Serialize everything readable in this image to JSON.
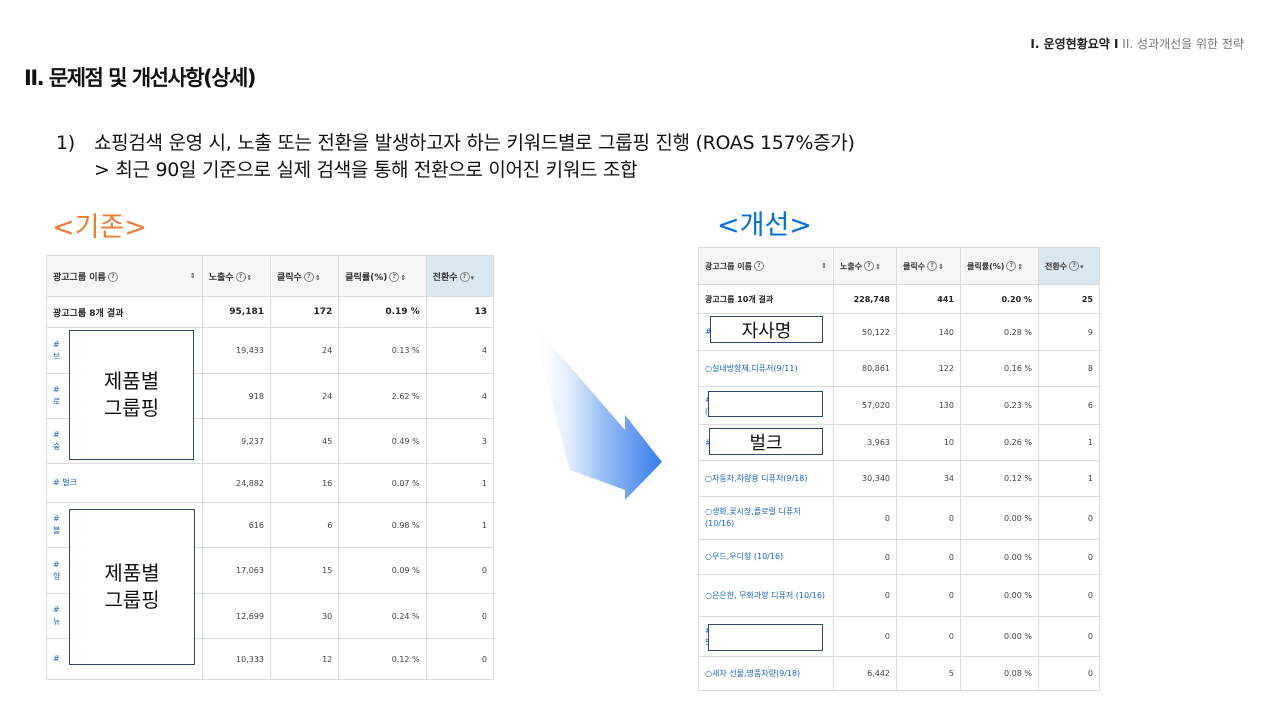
{
  "breadcrumb": {
    "active": "I. 운영현황요약 I",
    "inactive": "II. 성과개선을 위한 전략"
  },
  "page_title": "II. 문제점 및 개선사항(상세)",
  "description": {
    "number": "1)",
    "line1": "쇼핑검색 운영 시, 노출 또는 전환을 발생하고자 하는 키워드별로 그룹핑 진행 (ROAS 157%증가)",
    "line2": "> 최근 90일 기준으로 실제 검색을 통해 전환으로 이어진 키워드 조합"
  },
  "label_before": "<기존>",
  "label_after": "<개선>",
  "headers": [
    "광고그룹 이름",
    "노출수",
    "클릭수",
    "클릭률(%)",
    "전환수"
  ],
  "help_icon_glyph": "?",
  "before": {
    "summary": [
      "광고그룹 8개 결과",
      "95,181",
      "172",
      "0.19 %",
      "13"
    ],
    "rows": [
      {
        "l1": "#",
        "l2": "브",
        "v": [
          "19,433",
          "24",
          "0.13 %",
          "4"
        ]
      },
      {
        "l1": "#",
        "l2": "로",
        "v": [
          "918",
          "24",
          "2.62 %",
          "4"
        ]
      },
      {
        "l1": "#",
        "l2": "숲",
        "v": [
          "9,237",
          "45",
          "0.49 %",
          "3"
        ]
      },
      {
        "l1": "# 벌크",
        "l2": "",
        "v": [
          "24,882",
          "16",
          "0.07 %",
          "1"
        ]
      },
      {
        "l1": "#",
        "l2": "블",
        "v": [
          "616",
          "6",
          "0.98 %",
          "1"
        ]
      },
      {
        "l1": "#",
        "l2": "향",
        "v": [
          "17,063",
          "15",
          "0.09 %",
          "0"
        ]
      },
      {
        "l1": "#",
        "l2": "뉴",
        "v": [
          "12,699",
          "30",
          "0.24 %",
          "0"
        ]
      },
      {
        "l1": "#",
        "l2": "",
        "v": [
          "10,333",
          "12",
          "0.12 %",
          "0"
        ]
      }
    ],
    "overlay_text": "제품별\n그룹핑"
  },
  "after": {
    "summary": [
      "광고그룹 10개 결과",
      "228,748",
      "441",
      "0.20 %",
      "25"
    ],
    "rows": [
      {
        "name": "#",
        "v": [
          "50,122",
          "140",
          "0.28 %",
          "9"
        ]
      },
      {
        "name": "○실내방향제,디퓨저(9/11)",
        "v": [
          "80,861",
          "122",
          "0.16 %",
          "8"
        ]
      },
      {
        "name": "#\n(9",
        "v": [
          "57,020",
          "130",
          "0.23 %",
          "6"
        ]
      },
      {
        "name": "#",
        "v": [
          "3,963",
          "10",
          "0.26 %",
          "1"
        ]
      },
      {
        "name": "○자동차,차량용 디퓨저(9/18)",
        "v": [
          "30,340",
          "34",
          "0.12 %",
          "1"
        ]
      },
      {
        "name": "○생화,꽃시장,플로럴 디퓨저(10/16)",
        "v": [
          "0",
          "0",
          "0.00 %",
          "0"
        ]
      },
      {
        "name": "○우드,우디향 (10/16)",
        "v": [
          "0",
          "0",
          "0.00 %",
          "0"
        ]
      },
      {
        "name": "○은은한, 무화과향 디퓨저 (10/16)",
        "v": [
          "0",
          "0",
          "0.00 %",
          "0"
        ]
      },
      {
        "name": "#\n53",
        "v": [
          "0",
          "0",
          "0.00 %",
          "0"
        ]
      },
      {
        "name": "○새차 선물,명품차량(9/18)",
        "v": [
          "6,442",
          "5",
          "0.08 %",
          "0"
        ]
      }
    ],
    "overlay_company": "자사명",
    "overlay_bulk": "벌크"
  },
  "colors": {
    "before_label": "#ED7D31",
    "after_label": "#0070E0",
    "link": "#1a64c8",
    "arrow": "#1F6FE8"
  }
}
